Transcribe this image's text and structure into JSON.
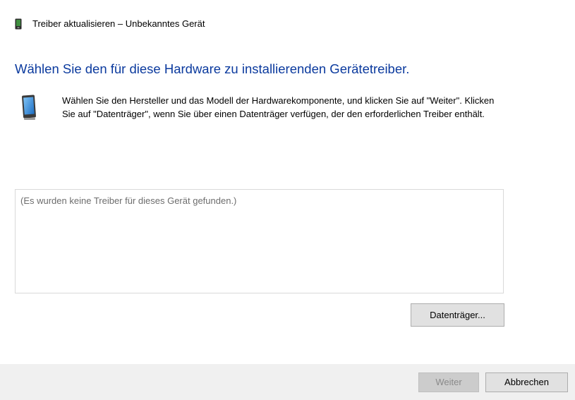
{
  "window": {
    "title": "Treiber aktualisieren – Unbekanntes Gerät",
    "title_icon": "device-manager-icon"
  },
  "main": {
    "heading": "Wählen Sie den für diese Hardware zu installierenden Gerätetreiber.",
    "instruction_icon": "mobile-device-icon",
    "description": "Wählen Sie den Hersteller und das Modell der Hardwarekomponente, und klicken Sie auf \"Weiter\". Klicken Sie auf \"Datenträger\", wenn Sie über einen Datenträger verfügen, der den erforderlichen Treiber enthält.",
    "driver_list": {
      "empty_message": "(Es wurden keine Treiber für dieses Gerät gefunden.)"
    },
    "have_disk_label": "Datenträger..."
  },
  "footer": {
    "next_label": "Weiter",
    "next_enabled": false,
    "cancel_label": "Abbrechen"
  },
  "colors": {
    "heading": "#0b3a9e",
    "footer_background": "#f0f0f0",
    "button_face": "#e1e1e1",
    "disabled_text": "#8a8a8a"
  }
}
